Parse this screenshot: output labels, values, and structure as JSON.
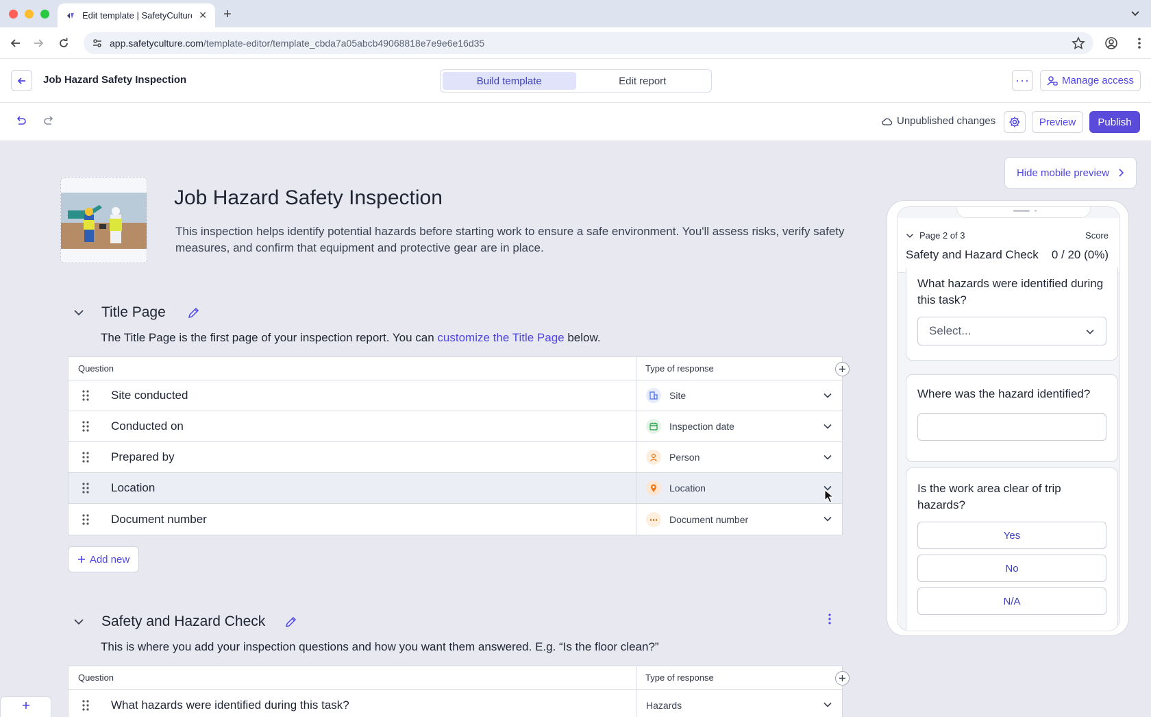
{
  "browser": {
    "tab_title": "Edit template | SafetyCulture",
    "url_host": "app.safetyculture.com",
    "url_path": "/template-editor/template_cbda7a05abcb49068818e7e9e6e16d35"
  },
  "header": {
    "title": "Job Hazard Safety Inspection",
    "tabs": [
      {
        "label": "Build template",
        "active": true
      },
      {
        "label": "Edit report",
        "active": false
      }
    ],
    "more_label": "···",
    "manage_access": "Manage access"
  },
  "toolbar": {
    "status": "Unpublished changes",
    "preview": "Preview",
    "publish": "Publish"
  },
  "template": {
    "title": "Job Hazard Safety Inspection",
    "description": "This inspection helps identify potential hazards before starting work to ensure a safe environment. You'll assess risks, verify safety measures, and confirm that equipment and protective gear are in place."
  },
  "title_page": {
    "title": "Title Page",
    "desc_before": "The Title Page is the first page of your inspection report. You can ",
    "desc_link": "customize the Title Page",
    "desc_after": " below.",
    "col_question": "Question",
    "col_response": "Type of response",
    "rows": [
      {
        "question": "Site conducted",
        "response": "Site",
        "icon": "site-icon",
        "color": "#5b7de8"
      },
      {
        "question": "Conducted on",
        "response": "Inspection date",
        "icon": "calendar-icon",
        "color": "#3aa655"
      },
      {
        "question": "Prepared by",
        "response": "Person",
        "icon": "person-icon",
        "color": "#e8893a"
      },
      {
        "question": "Location",
        "response": "Location",
        "icon": "location-pin-icon",
        "color": "#f07c1b"
      },
      {
        "question": "Document number",
        "response": "Document number",
        "icon": "number-icon",
        "color": "#e8893a"
      }
    ],
    "add_new": "Add new"
  },
  "safety_section": {
    "title": "Safety and Hazard Check",
    "description": "This is where you add your inspection questions and how you want them answered. E.g. “Is the floor clean?”",
    "col_question": "Question",
    "col_response": "Type of response",
    "rows": [
      {
        "question": "What hazards were identified during this task?",
        "response": "Hazards"
      }
    ]
  },
  "mobile_preview": {
    "hide_label": "Hide mobile preview",
    "page_label": "Page 2 of 3",
    "score_label": "Score",
    "section_title": "Safety and Hazard Check",
    "score_value": "0 / 20 (0%)",
    "q1": "What hazards were identified during this task?",
    "q1_placeholder": "Select...",
    "q2": "Where was the hazard identified?",
    "q3": "Is the work area clear of trip hazards?",
    "options": [
      "Yes",
      "No",
      "N/A"
    ]
  },
  "colors": {
    "accent": "#4f46e5",
    "publish": "#5a4bdb",
    "background": "#e7e8f0"
  }
}
